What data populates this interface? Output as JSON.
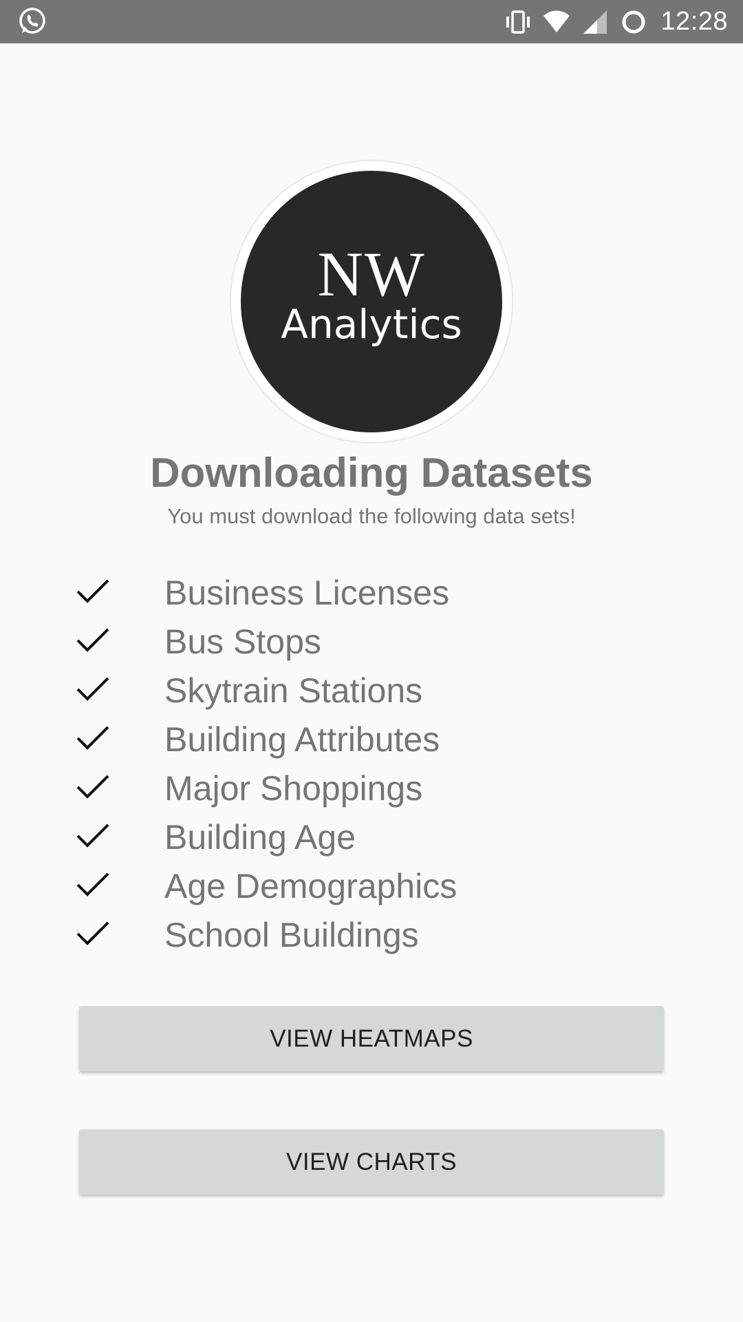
{
  "status_bar": {
    "left_icon": "whatsapp-icon",
    "right_icons": [
      "vibrate-icon",
      "wifi-icon",
      "cell-signal-icon",
      "sync-icon"
    ],
    "time": "12:28",
    "background": "#757575"
  },
  "logo": {
    "line1": "NW",
    "line2": "Analytics",
    "disc_color": "#282828"
  },
  "header": {
    "title": "Downloading Datasets",
    "subtitle": "You must download the following data sets!"
  },
  "datasets": [
    {
      "label": "Business Licenses",
      "icon": "check-icon"
    },
    {
      "label": "Bus Stops",
      "icon": "check-icon"
    },
    {
      "label": "Skytrain Stations",
      "icon": "check-icon"
    },
    {
      "label": "Building Attributes",
      "icon": "check-icon"
    },
    {
      "label": "Major Shoppings",
      "icon": "check-icon"
    },
    {
      "label": "Building Age",
      "icon": "check-icon"
    },
    {
      "label": "Age Demographics",
      "icon": "check-icon"
    },
    {
      "label": "School Buildings",
      "icon": "check-icon"
    }
  ],
  "buttons": {
    "heatmaps_label": "VIEW HEATMAPS",
    "charts_label": "VIEW CHARTS",
    "color": "#d6d7d7"
  },
  "colors": {
    "background": "#fafafa",
    "text_gray": "#757575"
  }
}
